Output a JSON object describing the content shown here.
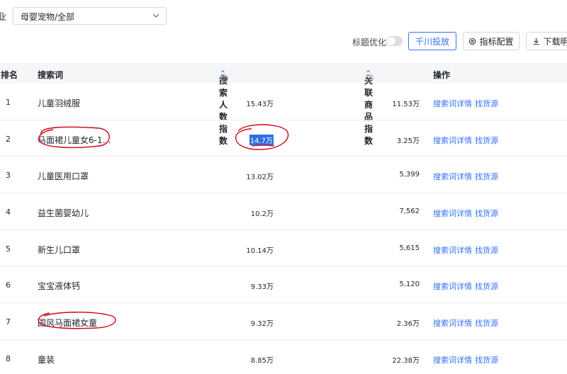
{
  "filter": {
    "industry_label": "业",
    "category_value": "母婴宠物/全部"
  },
  "toolbar": {
    "title_opt_label": "标题优化",
    "qianchuan_label": "千川投放",
    "metric_config_label": "指标配置",
    "download_label": "下载明"
  },
  "table": {
    "headers": {
      "rank": "排名",
      "keyword": "搜索词",
      "search_index": "搜索人数指数",
      "related_index": "关联商品指数",
      "ops": "操作"
    },
    "rows": [
      {
        "rank": "1",
        "keyword": "儿童羽绒服",
        "search": "15.43万",
        "related": "11.53万",
        "link1": "搜索词详情",
        "link2": "找货源"
      },
      {
        "rank": "2",
        "keyword": "马面裙儿童女6-1…",
        "search": "14.7万",
        "related": "3.25万",
        "link1": "搜索词详情",
        "link2": "找货源"
      },
      {
        "rank": "3",
        "keyword": "儿童医用口罩",
        "search": "13.02万",
        "related": "5,399",
        "link1": "搜索词详情",
        "link2": "找货源"
      },
      {
        "rank": "4",
        "keyword": "益生菌婴幼儿",
        "search": "10.2万",
        "related": "7,562",
        "link1": "搜索词详情",
        "link2": "找货源"
      },
      {
        "rank": "5",
        "keyword": "新生儿口罩",
        "search": "10.14万",
        "related": "5,615",
        "link1": "搜索词详情",
        "link2": "找货源"
      },
      {
        "rank": "6",
        "keyword": "宝宝液体钙",
        "search": "9.33万",
        "related": "5,120",
        "link1": "搜索词详情",
        "link2": "找货源"
      },
      {
        "rank": "7",
        "keyword": "国风马面裙女童",
        "search": "9.32万",
        "related": "2.36万",
        "link1": "搜索词详情",
        "link2": "找货源"
      },
      {
        "rank": "8",
        "keyword": "童装",
        "search": "8.85万",
        "related": "22.38万",
        "link1": "搜索词详情",
        "link2": "找货源"
      }
    ]
  },
  "colors": {
    "accent": "#3370ff",
    "annotation": "#d0021b",
    "header_bg": "#f5f6f7"
  }
}
